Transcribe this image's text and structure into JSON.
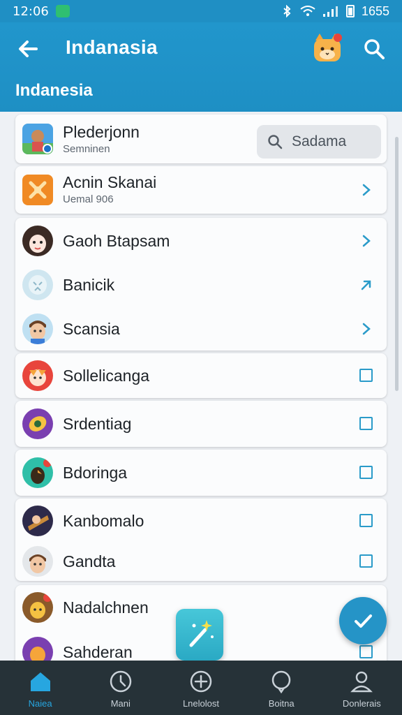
{
  "status_bar": {
    "time": "12:06",
    "right_text": "1655"
  },
  "app_bar": {
    "title": "Indanasia",
    "subtitle": "Indanesia"
  },
  "search": {
    "label": "Sadama"
  },
  "rows": [
    {
      "title": "Plederjonn",
      "sub": "Semninen"
    },
    {
      "title": "Acnin Skanai",
      "sub": "Uemal 906"
    },
    {
      "title": "Gaoh Btapsam"
    },
    {
      "title": "Banicik"
    },
    {
      "title": "Scansia"
    },
    {
      "title": "Sollelicanga"
    },
    {
      "title": "Srdentiag"
    },
    {
      "title": "Bdoringa"
    },
    {
      "title": "Kanbomalo"
    },
    {
      "title": "Gandta"
    },
    {
      "title": "Nadalchnen"
    },
    {
      "title": "Sahderan"
    }
  ],
  "bottom_nav": [
    {
      "label": "Naiea",
      "icon": "home-icon"
    },
    {
      "label": "Mani",
      "icon": "clock-icon"
    },
    {
      "label": "Lnelolost",
      "icon": "plus-circle-icon"
    },
    {
      "label": "Boitna",
      "icon": "chat-bubble-icon"
    },
    {
      "label": "Donlerais",
      "icon": "profile-icon"
    }
  ],
  "colors": {
    "accent": "#1f8fc4",
    "nav_bg": "#263238",
    "active_tab": "#27a6e0"
  }
}
